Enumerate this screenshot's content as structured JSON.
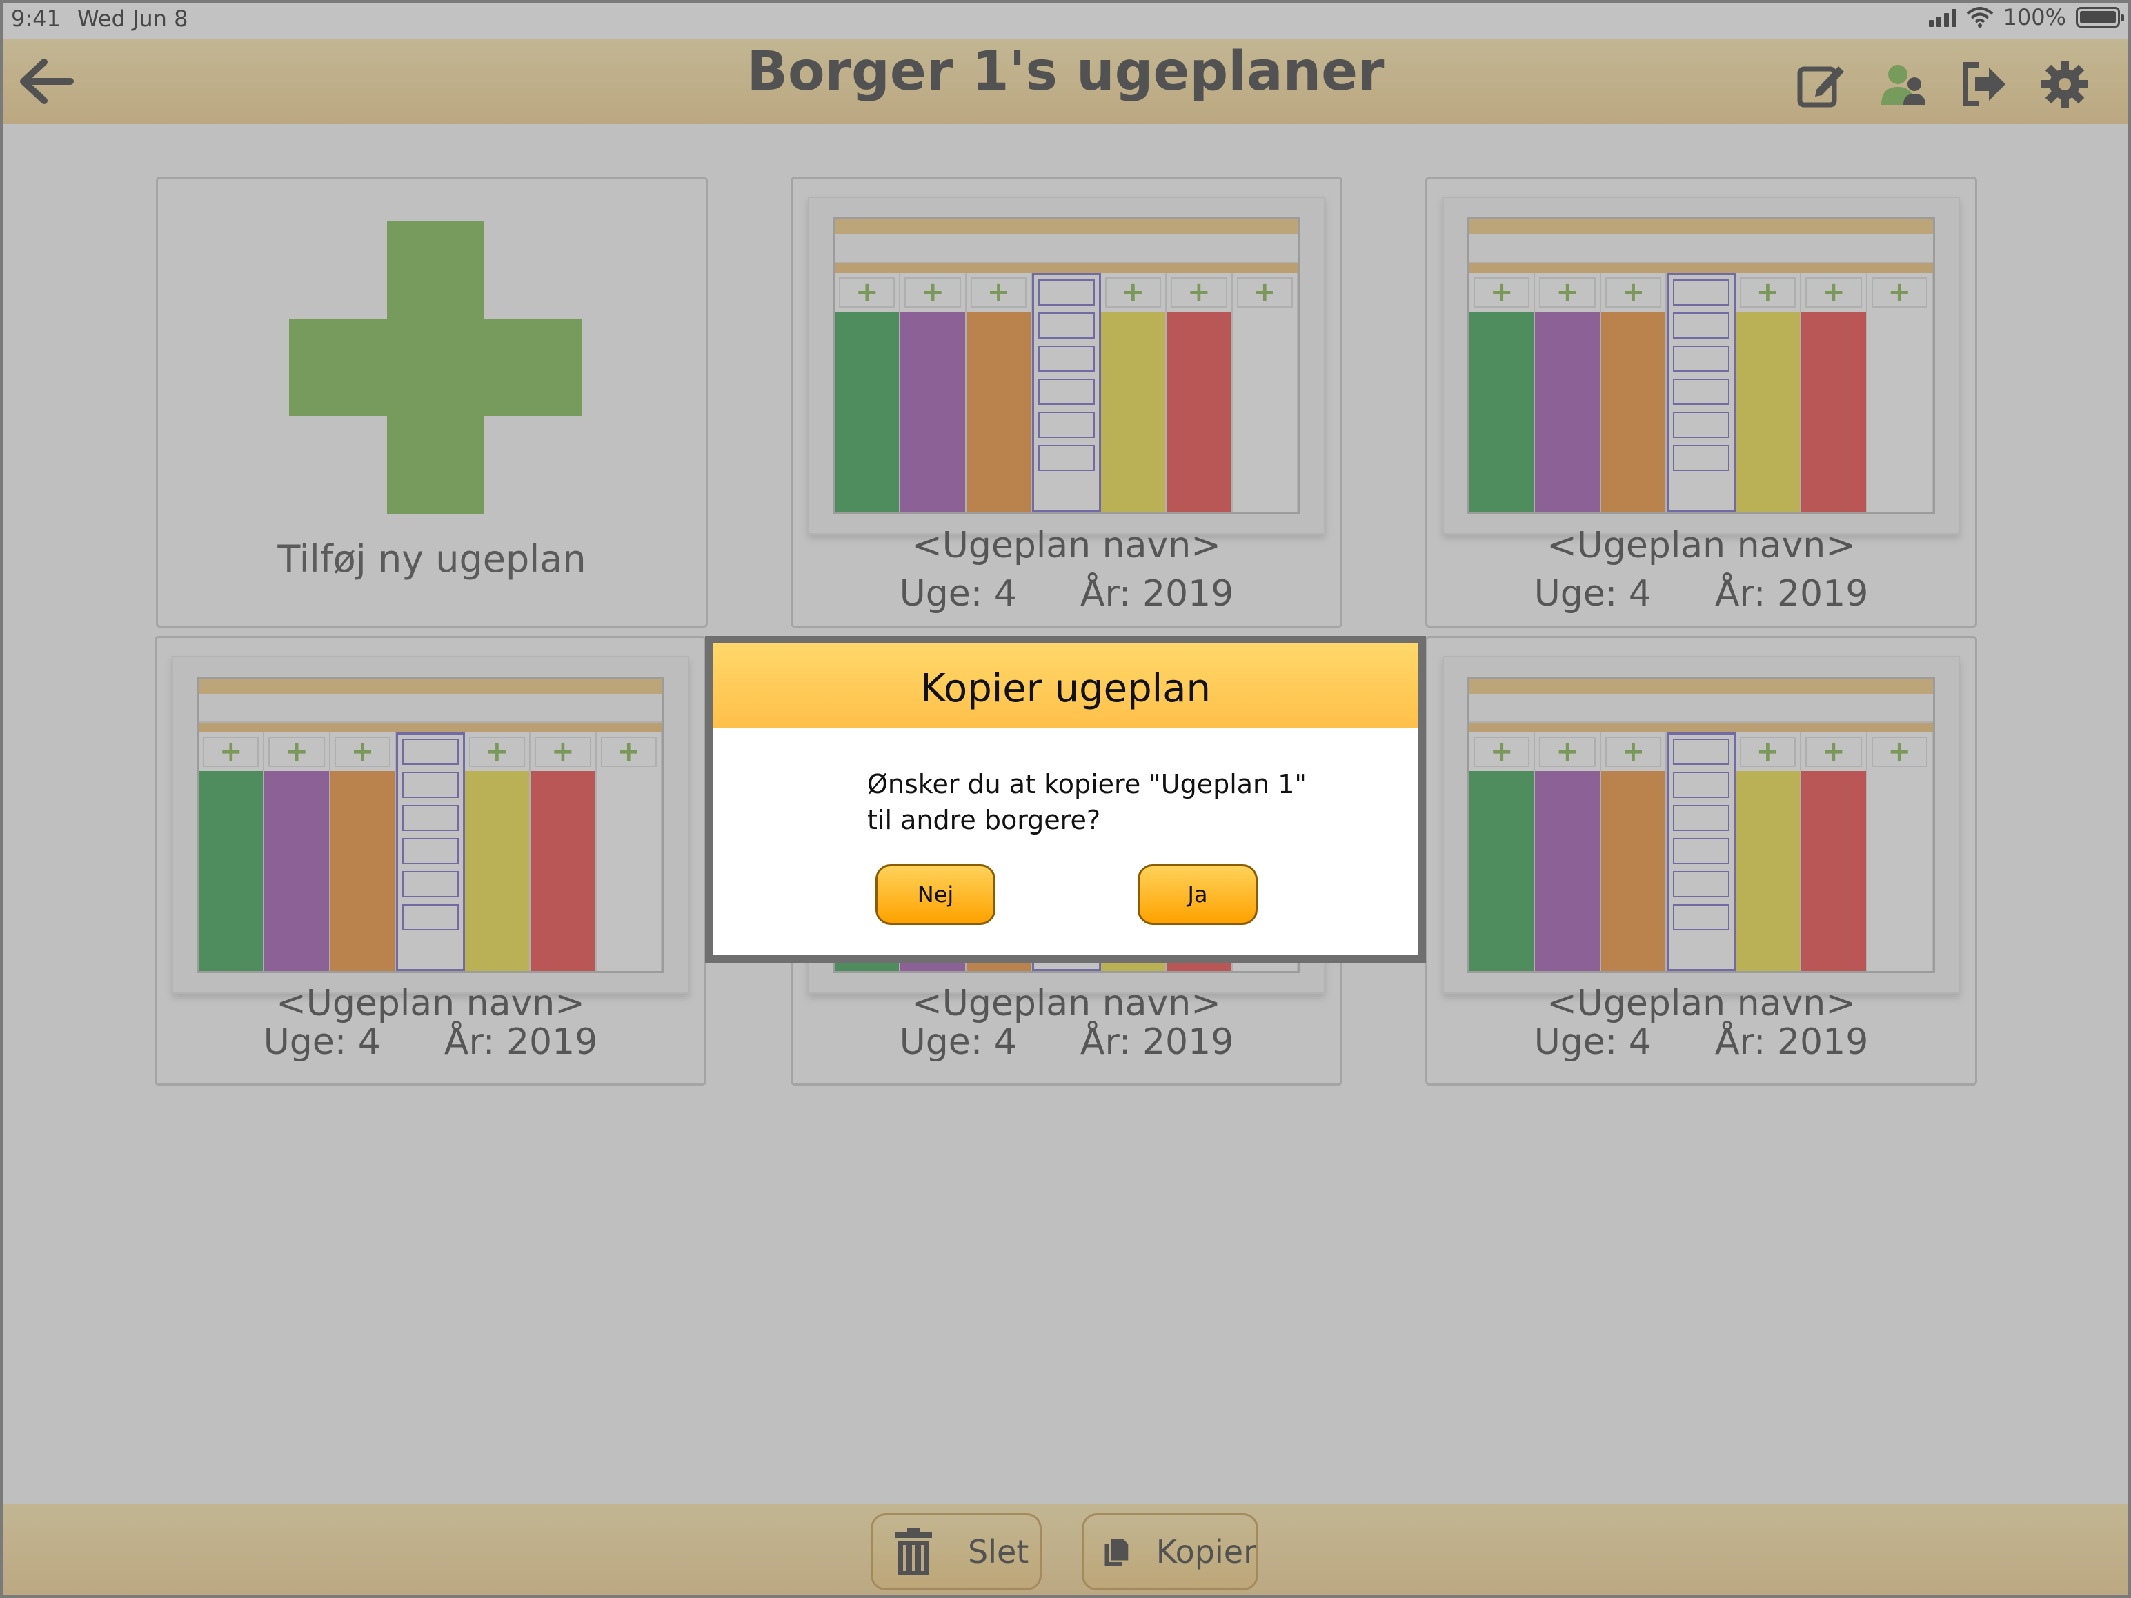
{
  "status_bar": {
    "time": "9:41",
    "date": "Wed Jun 8",
    "battery_text": "100%"
  },
  "header": {
    "title": "Borger 1's ugeplaner",
    "icons": [
      "back-arrow-icon",
      "edit-icon",
      "change-citizen-icon",
      "logout-icon",
      "settings-icon"
    ]
  },
  "add_card": {
    "label": "Tilføj ny ugeplan"
  },
  "weekplans": [
    {
      "name": "<Ugeplan navn>",
      "week": "Uge: 4",
      "year": "År: 2019"
    },
    {
      "name": "<Ugeplan navn>",
      "week": "Uge: 4",
      "year": "År: 2019"
    },
    {
      "name": "<Ugeplan navn>",
      "week": "Uge: 4",
      "year": "År: 2019"
    },
    {
      "name": "<Ugeplan navn>",
      "week": "Uge: 4",
      "year": "År: 2019"
    },
    {
      "name": "<Ugeplan navn>",
      "week": "Uge: 4",
      "year": "År: 2019"
    }
  ],
  "thumbnail_day_colors": [
    "#2e9e4a",
    "#9b4fb0",
    "#f08a2a",
    "#ffffff",
    "#f0de3a",
    "#ef3b3b",
    "#ffffff"
  ],
  "bottom_bar": {
    "delete_label": "Slet",
    "copy_label": "Kopier"
  },
  "dialog": {
    "title": "Kopier ugeplan",
    "message_line1": "Ønsker du at kopiere \"Ugeplan 1\"",
    "message_line2": "til andre borgere?",
    "no_label": "Nej",
    "yes_label": "Ja"
  },
  "colors": {
    "header_bg": "#f3d08a",
    "accent_green": "#76b846",
    "dialog_header": "#ffc04a",
    "button_orange": "#ffa200"
  }
}
